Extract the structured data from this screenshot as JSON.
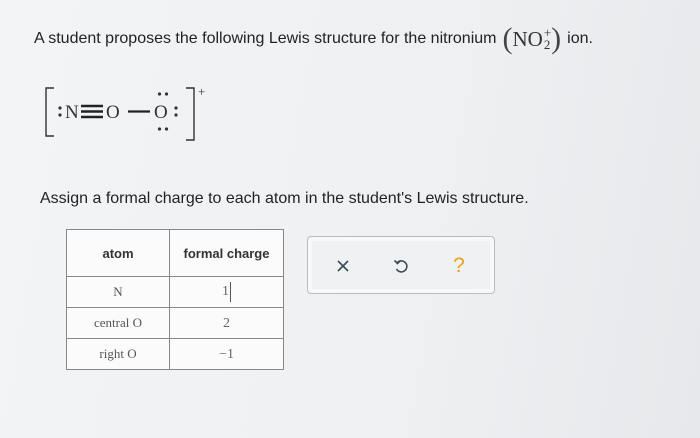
{
  "question": {
    "prefix": "A student proposes the following Lewis structure for the nitronium",
    "formula": {
      "base": "NO",
      "sub": "2",
      "sup": "+"
    },
    "suffix": "ion."
  },
  "lewis": {
    "atom_n": "N",
    "atom_o1": "O",
    "atom_o2": "O",
    "charge": "+"
  },
  "instruction": "Assign a formal charge to each atom in the student's Lewis structure.",
  "table": {
    "headers": [
      "atom",
      "formal charge"
    ],
    "rows": [
      {
        "atom": "N",
        "charge": "1"
      },
      {
        "atom": "central O",
        "charge": "2"
      },
      {
        "atom": "right O",
        "charge": "−1"
      }
    ]
  },
  "actions": {
    "clear_icon": "x-icon",
    "undo_icon": "undo-icon",
    "help_icon": "help-icon",
    "clear_glyph": "×",
    "help_glyph": "?",
    "help_color": "#e8a21c"
  }
}
